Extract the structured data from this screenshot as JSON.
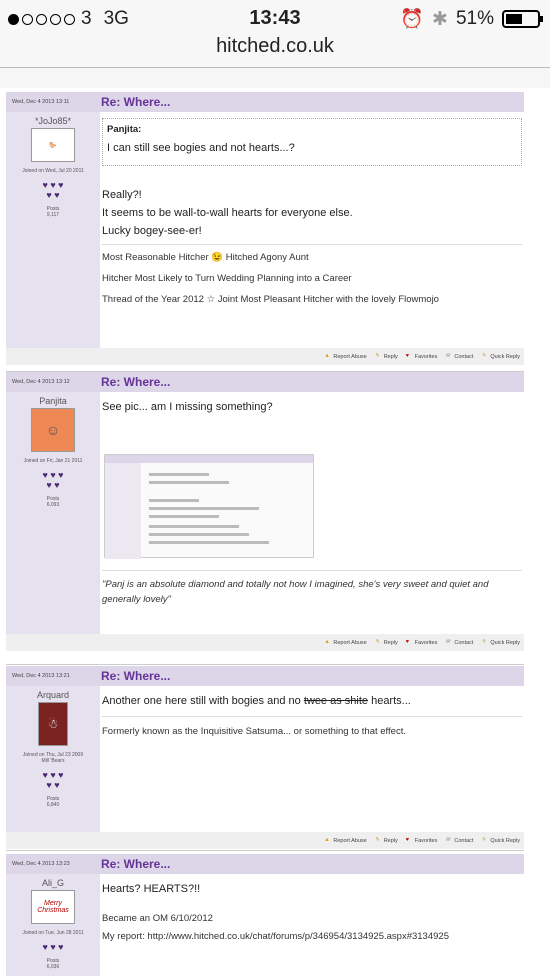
{
  "status": {
    "signal": "3",
    "network": "3G",
    "time": "13:43",
    "battery": "51%"
  },
  "url": "hitched.co.uk",
  "actions": {
    "report": "Report Abuse",
    "reply": "Reply",
    "favorites": "Favorites",
    "contact": "Contact",
    "quick": "Quick Reply"
  },
  "posts": [
    {
      "date": "Wed, Dec 4 2013 13:11",
      "title": "Re: Where...",
      "user": "*JoJo85*",
      "joined": "Joined on Wed, Jul 20 2011",
      "posts_label": "Posts",
      "posts": "9,117",
      "quote_author": "Panjita:",
      "quote": "I can still see bogies and not hearts...?",
      "lines": [
        "Really?!",
        "It seems to be wall-to-wall hearts for everyone else.",
        "Lucky bogey-see-er!"
      ],
      "sig": [
        "Most Reasonable Hitcher 😉 Hitched Agony Aunt",
        "Hitcher Most Likely to Turn Wedding Planning into a Career",
        "Thread of the Year 2012 ☆ Joint Most Pleasant Hitcher with the lovely Flowmojo"
      ]
    },
    {
      "date": "Wed, Dec 4 2013 13:12",
      "title": "Re: Where...",
      "user": "Panjita",
      "joined": "Joined on Fri, Jan 21 2011",
      "posts_label": "Posts",
      "posts": "6,093",
      "text": "See pic... am I missing something?",
      "sig": "\"Panj is an absolute diamond and totally not how I imagined, she's very sweet and quiet and generally lovely\""
    },
    {
      "date": "Wed, Dec 4 2013 13:21",
      "title": "Re: Where...",
      "user": "Arquard",
      "joined": "Joined on Thu, Jul 23 2009",
      "extra": "Mill 'Bears",
      "posts_label": "Posts",
      "posts": "6,840",
      "text_a": "Another one here still with bogies and no",
      "text_strike": "twee as shite",
      "text_b": "hearts...",
      "sig": "Formerly known as the Inquisitive Satsuma... or something to that effect."
    },
    {
      "date": "Wed, Dec 4 2013 13:23",
      "title": "Re: Where...",
      "user": "Ali_G",
      "joined": "Joined on Tue, Jun 28 2011",
      "posts_label": "Posts",
      "posts": "6,036",
      "text": "Hearts? HEARTS?!!",
      "sig1": "Became an OM 6/10/2012",
      "sig2_label": "My report:",
      "sig2_link": "http://www.hitched.co.uk/chat/forums/p/346954/3134925.aspx#3134925",
      "avatar_text": "Merry Christmas"
    }
  ],
  "colors": {
    "accent": "#663399",
    "header": "#ddd6e8",
    "side": "#e6e1ef"
  }
}
